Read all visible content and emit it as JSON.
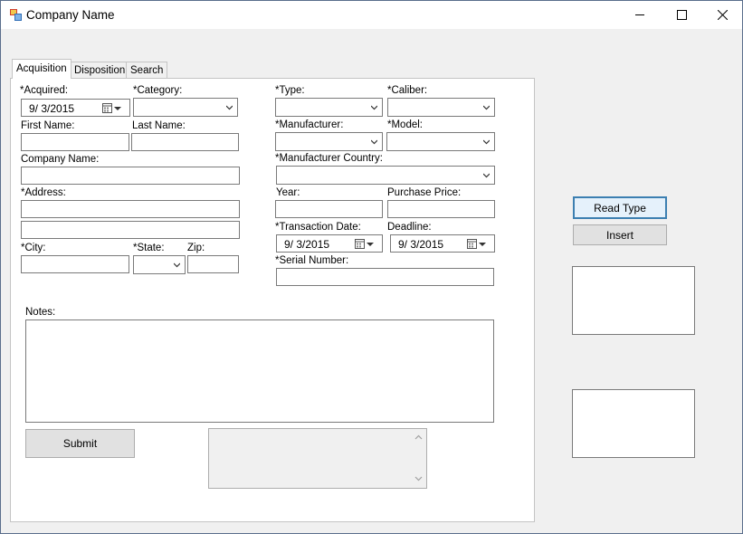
{
  "window": {
    "title": "Company Name",
    "controls": {
      "minimize": "—",
      "maximize": "☐",
      "close": "✕"
    }
  },
  "tabs": [
    "Acquisition",
    "Disposition",
    "Search"
  ],
  "form": {
    "acquired_label": "*Acquired:",
    "acquired_value": "9/  3/2015",
    "category_label": "*Category:",
    "first_name_label": "First Name:",
    "last_name_label": "Last Name:",
    "company_name_label": "Company Name:",
    "address_label": "*Address:",
    "city_label": "*City:",
    "state_label": "*State:",
    "zip_label": "Zip:",
    "type_label": "*Type:",
    "caliber_label": "*Caliber:",
    "manufacturer_label": "*Manufacturer:",
    "model_label": "*Model:",
    "manufacturer_country_label": "*Manufacturer Country:",
    "year_label": "Year:",
    "purchase_price_label": "Purchase Price:",
    "transaction_date_label": "*Transaction Date:",
    "transaction_date_value": "9/  3/2015",
    "deadline_label": "Deadline:",
    "deadline_value": "9/  3/2015",
    "serial_number_label": "*Serial Number:",
    "notes_label": "Notes:",
    "submit_label": "Submit"
  },
  "side": {
    "read_type_label": "Read Type",
    "insert_label": "Insert"
  },
  "colors": {
    "default_button_border": "#3c7fb1",
    "default_button_bg": "#e5f1fb"
  }
}
